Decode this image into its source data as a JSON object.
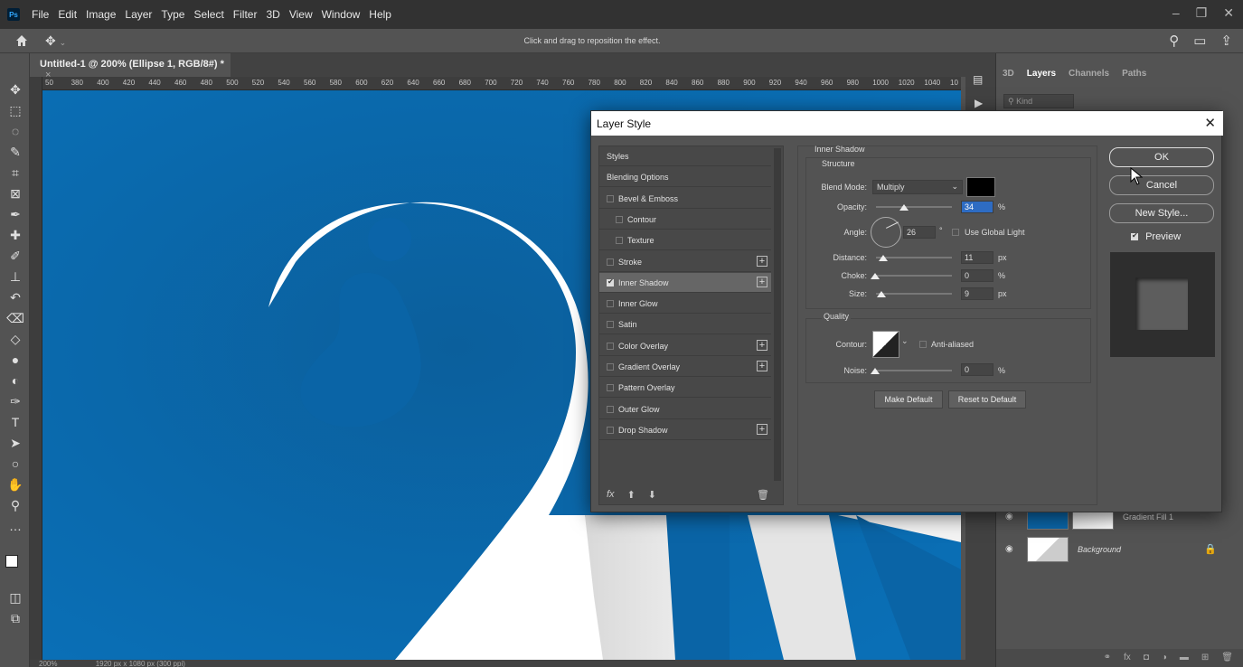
{
  "menubar": {
    "logo": "Ps",
    "items": [
      "File",
      "Edit",
      "Image",
      "Layer",
      "Type",
      "Select",
      "Filter",
      "3D",
      "View",
      "Window",
      "Help"
    ]
  },
  "optionsbar": {
    "hint": "Click and drag to reposition the effect."
  },
  "document": {
    "tab_title": "Untitled-1 @ 200% (Ellipse 1, RGB/8#) *",
    "zoom": "200%",
    "dimensions": "1920 px x 1080 px (300 ppi)",
    "ruler_ticks": [
      "50",
      "380",
      "400",
      "420",
      "440",
      "460",
      "480",
      "500",
      "520",
      "540",
      "560",
      "580",
      "600",
      "620",
      "640",
      "660",
      "680",
      "700",
      "720",
      "740",
      "760",
      "780",
      "800",
      "820",
      "840",
      "860",
      "880",
      "900",
      "920",
      "940",
      "960",
      "980",
      "1000",
      "1020",
      "1040",
      "10"
    ],
    "background_color": "#0a64a6"
  },
  "layers_panel": {
    "tabs": [
      "3D",
      "Layers",
      "Channels",
      "Paths"
    ],
    "active_tab": "Layers",
    "search_placeholder": "Kind",
    "layers": [
      {
        "name": "Gradient Fill 1",
        "visible": true
      },
      {
        "name": "Background",
        "visible": true,
        "locked": true
      }
    ]
  },
  "dialog": {
    "title": "Layer Style",
    "styles_list": [
      {
        "label": "Styles",
        "checkbox": false,
        "plus": false
      },
      {
        "label": "Blending Options",
        "checkbox": false,
        "plus": false
      },
      {
        "label": "Bevel & Emboss",
        "checkbox": true,
        "checked": false,
        "plus": false
      },
      {
        "label": "Contour",
        "checkbox": true,
        "checked": false,
        "plus": false,
        "indent": true
      },
      {
        "label": "Texture",
        "checkbox": true,
        "checked": false,
        "plus": false,
        "indent": true
      },
      {
        "label": "Stroke",
        "checkbox": true,
        "checked": false,
        "plus": true
      },
      {
        "label": "Inner Shadow",
        "checkbox": true,
        "checked": true,
        "plus": true,
        "active": true
      },
      {
        "label": "Inner Glow",
        "checkbox": true,
        "checked": false,
        "plus": false
      },
      {
        "label": "Satin",
        "checkbox": true,
        "checked": false,
        "plus": false
      },
      {
        "label": "Color Overlay",
        "checkbox": true,
        "checked": false,
        "plus": true
      },
      {
        "label": "Gradient Overlay",
        "checkbox": true,
        "checked": false,
        "plus": true
      },
      {
        "label": "Pattern Overlay",
        "checkbox": true,
        "checked": false,
        "plus": false
      },
      {
        "label": "Outer Glow",
        "checkbox": true,
        "checked": false,
        "plus": false
      },
      {
        "label": "Drop Shadow",
        "checkbox": true,
        "checked": false,
        "plus": true
      }
    ],
    "list_footer": {
      "fx": "fx",
      "up": "⬆",
      "down": "⬇",
      "trash": "🗑"
    },
    "inner_shadow": {
      "section_title": "Inner Shadow",
      "structure_title": "Structure",
      "blend_mode_label": "Blend Mode:",
      "blend_mode_value": "Multiply",
      "shadow_color": "#000000",
      "opacity_label": "Opacity:",
      "opacity_value": "34",
      "opacity_unit": "%",
      "angle_label": "Angle:",
      "angle_value": "26",
      "angle_unit": "°",
      "global_light_label": "Use Global Light",
      "distance_label": "Distance:",
      "distance_value": "11",
      "distance_unit": "px",
      "choke_label": "Choke:",
      "choke_value": "0",
      "choke_unit": "%",
      "size_label": "Size:",
      "size_value": "9",
      "size_unit": "px",
      "quality_title": "Quality",
      "contour_label": "Contour:",
      "anti_aliased_label": "Anti-aliased",
      "noise_label": "Noise:",
      "noise_value": "0",
      "noise_unit": "%",
      "make_default": "Make Default",
      "reset_default": "Reset to Default"
    },
    "buttons": {
      "ok": "OK",
      "cancel": "Cancel",
      "new_style": "New Style...",
      "preview": "Preview"
    }
  }
}
